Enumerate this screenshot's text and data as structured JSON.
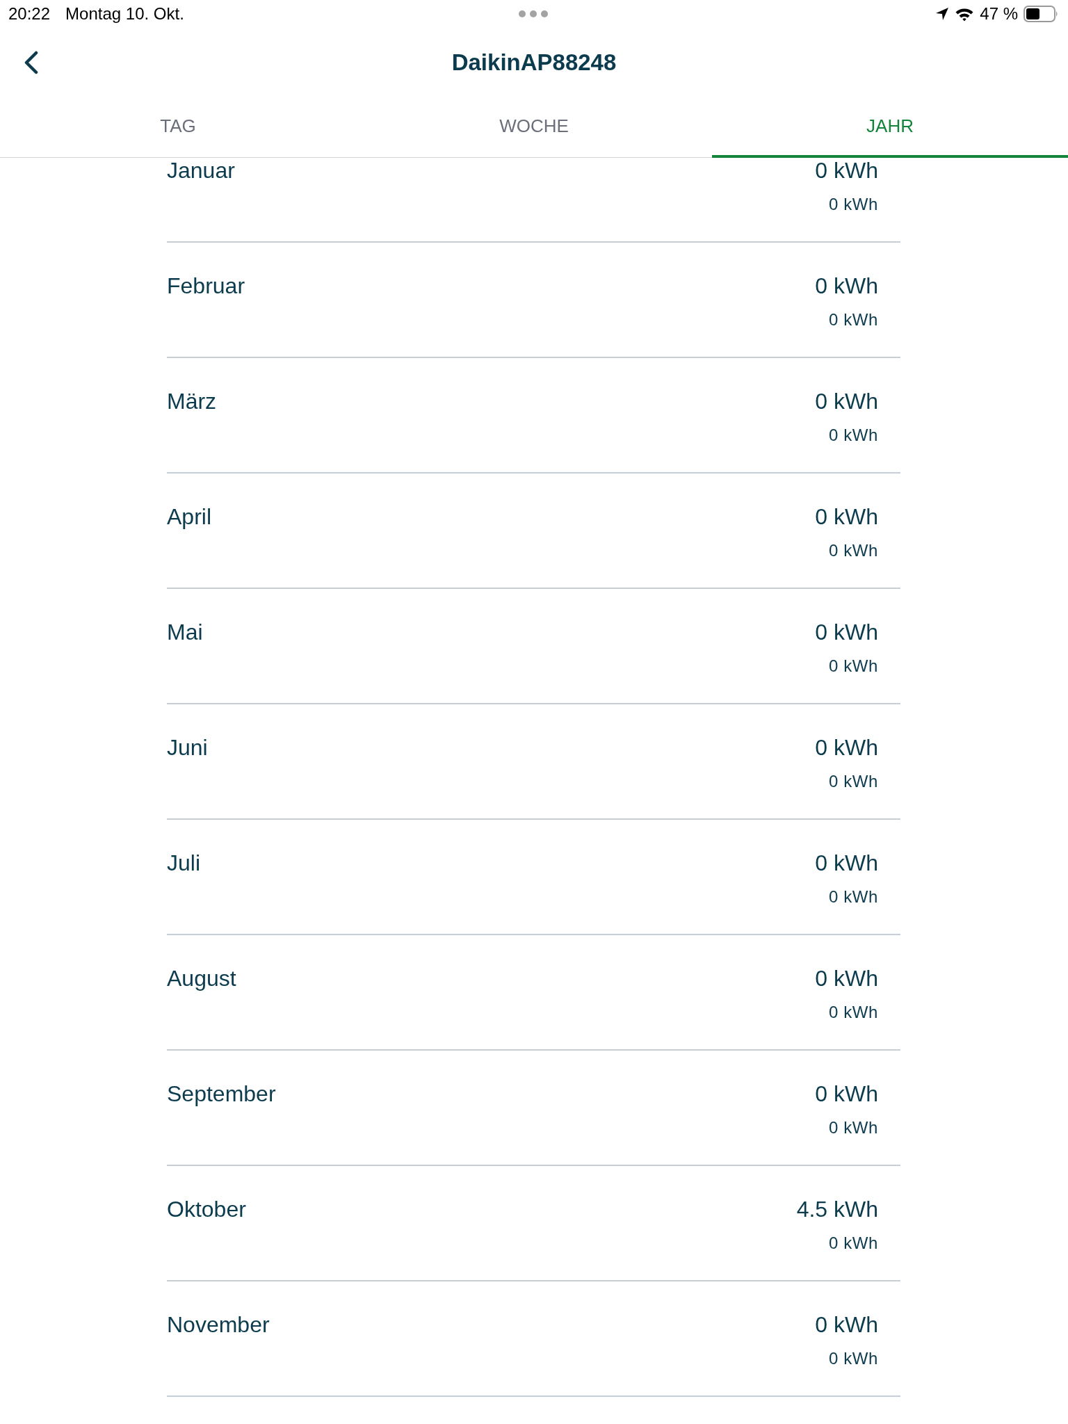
{
  "status_bar": {
    "time": "20:22",
    "date": "Montag 10. Okt.",
    "battery_percent": "47 %"
  },
  "nav": {
    "title": "DaikinAP88248"
  },
  "tabs": [
    {
      "label": "TAG",
      "selected": false
    },
    {
      "label": "WOCHE",
      "selected": false
    },
    {
      "label": "JAHR",
      "selected": true
    }
  ],
  "months": [
    {
      "name": "Januar",
      "value": "0 kWh",
      "secondary_value": "0 kWh"
    },
    {
      "name": "Februar",
      "value": "0 kWh",
      "secondary_value": "0 kWh"
    },
    {
      "name": "März",
      "value": "0 kWh",
      "secondary_value": "0 kWh"
    },
    {
      "name": "April",
      "value": "0 kWh",
      "secondary_value": "0 kWh"
    },
    {
      "name": "Mai",
      "value": "0 kWh",
      "secondary_value": "0 kWh"
    },
    {
      "name": "Juni",
      "value": "0 kWh",
      "secondary_value": "0 kWh"
    },
    {
      "name": "Juli",
      "value": "0 kWh",
      "secondary_value": "0 kWh"
    },
    {
      "name": "August",
      "value": "0 kWh",
      "secondary_value": "0 kWh"
    },
    {
      "name": "September",
      "value": "0 kWh",
      "secondary_value": "0 kWh"
    },
    {
      "name": "Oktober",
      "value": "4.5 kWh",
      "secondary_value": "0 kWh"
    },
    {
      "name": "November",
      "value": "0 kWh",
      "secondary_value": "0 kWh"
    }
  ]
}
